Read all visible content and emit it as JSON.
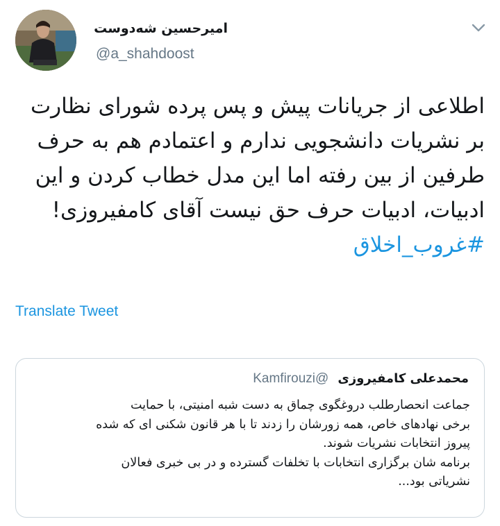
{
  "author": {
    "display_name": "امیرحسین شه‌دوست",
    "handle": "@a_shahdoost",
    "avatar_icon": "profile-photo"
  },
  "menu_icon": "chevron-down-icon",
  "tweet": {
    "lines": [
      "اطلاعی از جریانات پیش و پس پرده شورای نظارت",
      "بر نشریات دانشجویی ندارم و اعتمادم هم به حرف",
      "طرفین از بین رفته اما این مدل خطاب کردن و این",
      "ادبیات، ادبیات حرف حق نیست آقای کامفیروزی!"
    ],
    "hashtag": "#غروب_اخلاق"
  },
  "translate_label": "Translate Tweet",
  "quoted": {
    "name": "محمدعلی کامفیروزی",
    "handle": "@Kamfirouzi",
    "lines": [
      "جماعت انحصارطلب دروغگوی چماق به دست شبه امنیتی، با حمایت",
      "برخی نهادهای خاص، همه زورشان را زدند تا با هر قانون شکنی ای که شده",
      "پیروز انتخابات نشریات شوند.",
      "برنامه شان برگزاری انتخابات با تخلفات گسترده و در بی خبری فعالان",
      "نشریاتی بود..."
    ]
  },
  "colors": {
    "link": "#1b95e0",
    "secondary_text": "#657786",
    "border": "#ccd6dd"
  }
}
